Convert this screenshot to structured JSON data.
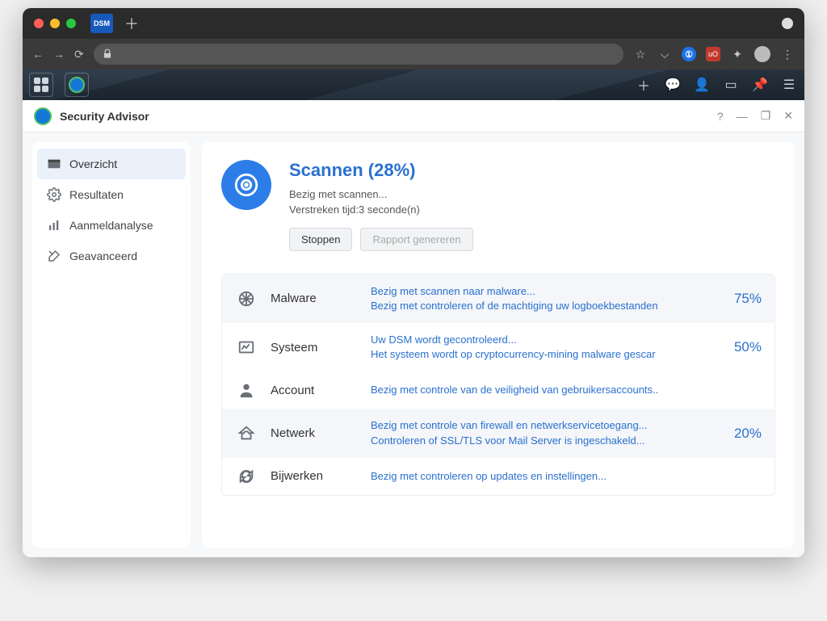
{
  "browser": {
    "tab_label": "DSM"
  },
  "app": {
    "title": "Security Advisor"
  },
  "sidebar": {
    "items": [
      {
        "label": "Overzicht",
        "active": true
      },
      {
        "label": "Resultaten",
        "active": false
      },
      {
        "label": "Aanmeldanalyse",
        "active": false
      },
      {
        "label": "Geavanceerd",
        "active": false
      }
    ]
  },
  "scan": {
    "title": "Scannen (28%)",
    "status_line": "Bezig met scannen...",
    "elapsed": "Verstreken tijd:3 seconde(n)",
    "stop_label": "Stoppen",
    "report_label": "Rapport genereren"
  },
  "categories": [
    {
      "name": "Malware",
      "lines": [
        "Bezig met scannen naar malware...",
        "Bezig met controleren of de machtiging uw logboekbestanden"
      ],
      "pct": "75%"
    },
    {
      "name": "Systeem",
      "lines": [
        "Uw DSM wordt gecontroleerd...",
        "Het systeem wordt op cryptocurrency-mining malware gescar"
      ],
      "pct": "50%"
    },
    {
      "name": "Account",
      "lines": [
        "Bezig met controle van de veiligheid van gebruikersaccounts.."
      ],
      "pct": ""
    },
    {
      "name": "Netwerk",
      "lines": [
        "Bezig met controle van firewall en netwerkservicetoegang...",
        "Controleren of SSL/TLS voor Mail Server is ingeschakeld..."
      ],
      "pct": "20%"
    },
    {
      "name": "Bijwerken",
      "lines": [
        "Bezig met controleren op updates en instellingen..."
      ],
      "pct": ""
    }
  ]
}
